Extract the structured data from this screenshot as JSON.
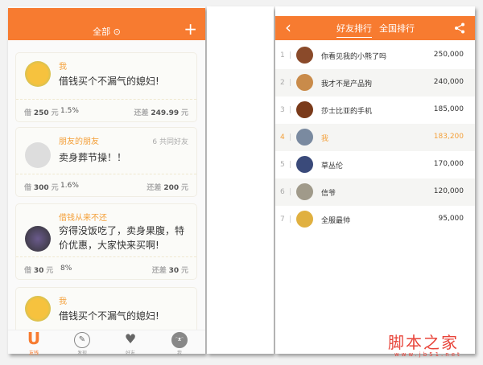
{
  "left": {
    "header": {
      "title": "全部 ⊙",
      "add": "+"
    },
    "cards": [
      {
        "name": "我",
        "message": "借钱买个不漏气的媳妇!",
        "borrow_label": "借",
        "amount": "250",
        "unit": "元",
        "rate": "1.5%",
        "remain_label": "还差",
        "remain": "249.99",
        "remain_unit": "元",
        "mutual": ""
      },
      {
        "name": "朋友的朋友",
        "message": "卖身葬节操！！",
        "borrow_label": "借",
        "amount": "300",
        "unit": "元",
        "rate": "1.6%",
        "remain_label": "还差",
        "remain": "200",
        "remain_unit": "元",
        "mutual": "6 共同好友"
      },
      {
        "name": "借钱从来不还",
        "message": "穷得没饭吃了，卖身果腹，特价优惠，大家快来买啊!",
        "borrow_label": "借",
        "amount": "30",
        "unit": "元",
        "rate": "8%",
        "remain_label": "还差",
        "remain": "30",
        "remain_unit": "元",
        "mutual": ""
      },
      {
        "name": "我",
        "message": "借钱买个不漏气的媳妇!"
      }
    ],
    "tabs": [
      {
        "label": "友钱",
        "icon": "U"
      },
      {
        "label": "发现",
        "icon": "✎"
      },
      {
        "label": "好友",
        "icon": "♥"
      },
      {
        "label": "我",
        "icon": "ᵔᴥᵔ"
      }
    ]
  },
  "right": {
    "header": {
      "back": "‹",
      "tabs": [
        "好友排行",
        "全国排行"
      ],
      "share": "share-icon"
    },
    "ranking": [
      {
        "rank": "1",
        "name": "你看见我的小熊了吗",
        "score": "250,000"
      },
      {
        "rank": "2",
        "name": "我才不是产品狗",
        "score": "240,000"
      },
      {
        "rank": "3",
        "name": "莎士比亚的手机",
        "score": "185,000"
      },
      {
        "rank": "4",
        "name": "我",
        "score": "183,200"
      },
      {
        "rank": "5",
        "name": "草丛伦",
        "score": "170,000"
      },
      {
        "rank": "6",
        "name": "信爷",
        "score": "120,000"
      },
      {
        "rank": "7",
        "name": "全服最帅",
        "score": "95,000"
      }
    ]
  },
  "watermark": {
    "text": "脚本之家",
    "url": "www.jb51.net"
  },
  "colors": {
    "accent": "#f77b30",
    "name": "#f4a03a"
  }
}
